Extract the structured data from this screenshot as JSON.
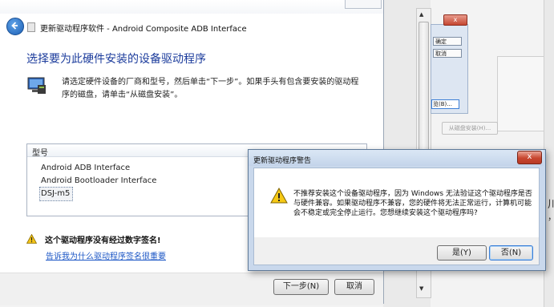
{
  "main_window": {
    "title": "更新驱动程序软件 - Android Composite ADB Interface",
    "heading": "选择要为此硬件安装的设备驱动程序",
    "description": "请选定硬件设备的厂商和型号，然后单击“下一步”。如果手头有包含要安装的驱动程序的磁盘，请单击“从磁盘安装”。",
    "model_header": "型号",
    "models": [
      "Android ADB Interface",
      "Android Bootloader Interface",
      "DSJ-m5"
    ],
    "unsigned_warning": "这个驱动程序没有经过数字签名!",
    "signing_link": "告诉我为什么驱动程序签名很重要",
    "next_button": "下一步(N)",
    "cancel_button": "取消"
  },
  "background_window": {
    "confirm_button": "确定",
    "cancel_button": "取消",
    "browse_button": "览(B)...",
    "disk_button": "从磁盘安装(H)...",
    "close_glyph": "x",
    "edge_char_1": "川",
    "edge_char_2": "，"
  },
  "warning_dialog": {
    "title": "更新驱动程序警告",
    "message": "不推荐安装这个设备驱动程序，因为 Windows 无法验证这个驱动程序是否与硬件兼容。如果驱动程序不兼容，您的硬件将无法正常运行，计算机可能会不稳定或完全停止运行。您想继续安装这个驱动程序吗?",
    "yes_button": "是(Y)",
    "no_button": "否(N)",
    "close_glyph": "x"
  }
}
